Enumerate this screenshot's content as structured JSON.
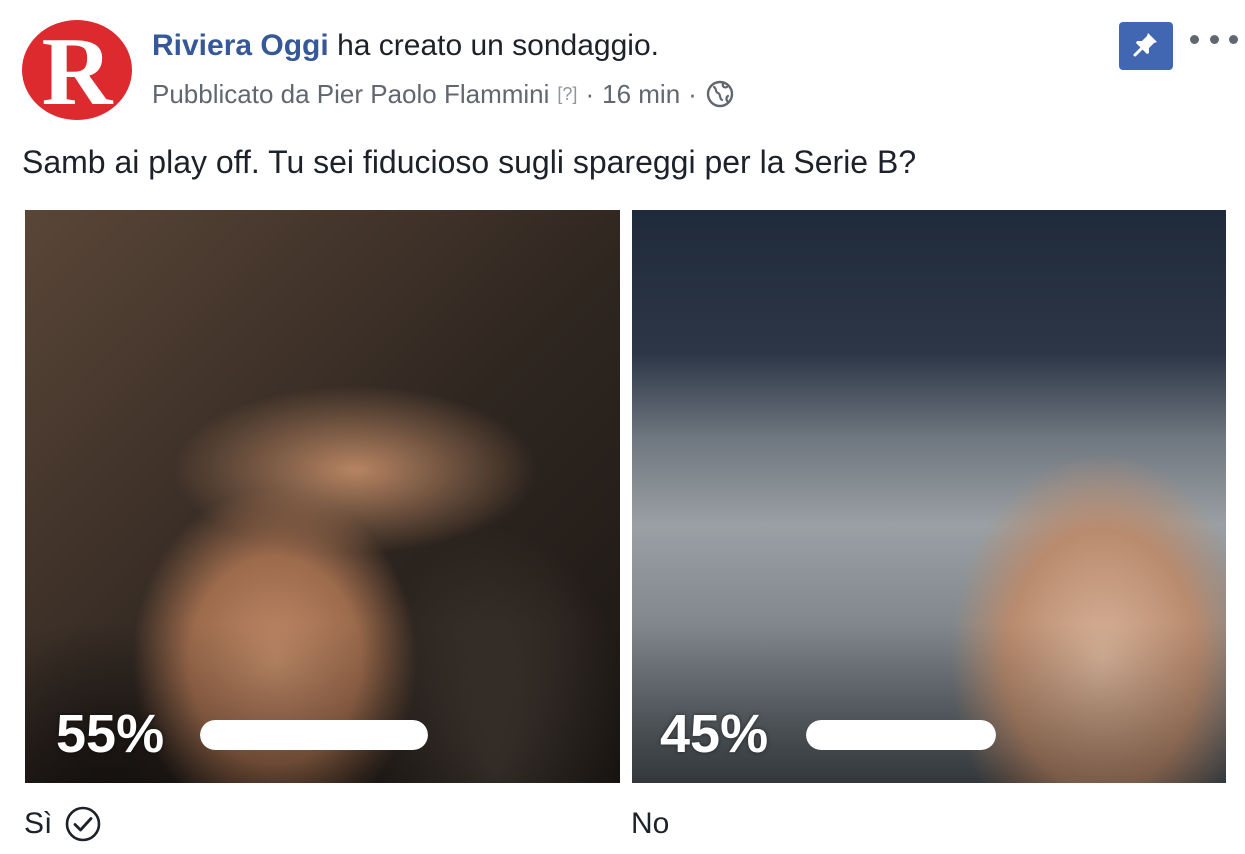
{
  "post": {
    "page_name": "Riviera Oggi",
    "action_text": "ha creato un sondaggio.",
    "published_by": "Pubblicato da Pier Paolo Flammini",
    "help_marker": "[?]",
    "separator": "·",
    "time": "16 min",
    "privacy_icon": "globe-icon",
    "avatar_letter": "R",
    "avatar_color": "#dd2a2f",
    "pin_icon": "pin-icon",
    "pin_button_color": "#4267b2",
    "more_icon": "more-icon"
  },
  "poll": {
    "question": "Samb ai play off. Tu sei fiducioso sugli spareggi per la Serie B?",
    "options": [
      {
        "label": "Sì",
        "percent_text": "55%",
        "percent": 55,
        "selected": true,
        "selected_icon": "check-circle-icon"
      },
      {
        "label": "No",
        "percent_text": "45%",
        "percent": 45,
        "selected": false
      }
    ]
  }
}
